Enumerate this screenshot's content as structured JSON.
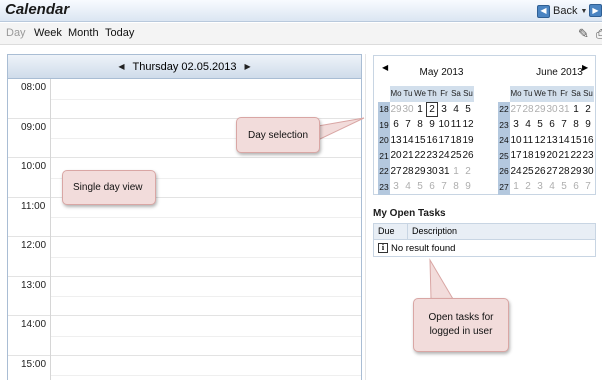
{
  "app": {
    "title": "Calendar"
  },
  "header": {
    "back_label": "Back",
    "back_icon": "back-arrow-icon",
    "exit_icon": "exit-icon"
  },
  "toolbar": {
    "views": [
      "Day",
      "Week",
      "Month",
      "Today"
    ],
    "active_view": "Day",
    "settings_icon": "settings-icon",
    "print_icon": "print-icon"
  },
  "day_view": {
    "date_label": "Thursday 02.05.2013",
    "hours": [
      "08:00",
      "09:00",
      "10:00",
      "11:00",
      "12:00",
      "13:00",
      "14:00",
      "15:00"
    ]
  },
  "navigator": {
    "weekday_headers": [
      "Mo",
      "Tu",
      "We",
      "Th",
      "Fr",
      "Sa",
      "Su"
    ],
    "selected_date": "02.05.2013",
    "months": [
      {
        "title": "May 2013",
        "weeks": [
          {
            "week": "18",
            "days": [
              [
                "29",
                "other"
              ],
              [
                "30",
                "other"
              ],
              [
                "1",
                ""
              ],
              [
                "2",
                "sel"
              ],
              [
                "3",
                ""
              ],
              [
                "4",
                ""
              ],
              [
                "5",
                ""
              ]
            ]
          },
          {
            "week": "19",
            "days": [
              [
                "6",
                ""
              ],
              [
                "7",
                ""
              ],
              [
                "8",
                ""
              ],
              [
                "9",
                ""
              ],
              [
                "10",
                ""
              ],
              [
                "11",
                ""
              ],
              [
                "12",
                ""
              ]
            ]
          },
          {
            "week": "20",
            "days": [
              [
                "13",
                ""
              ],
              [
                "14",
                ""
              ],
              [
                "15",
                ""
              ],
              [
                "16",
                ""
              ],
              [
                "17",
                ""
              ],
              [
                "18",
                ""
              ],
              [
                "19",
                ""
              ]
            ]
          },
          {
            "week": "21",
            "days": [
              [
                "20",
                ""
              ],
              [
                "21",
                ""
              ],
              [
                "22",
                ""
              ],
              [
                "23",
                ""
              ],
              [
                "24",
                ""
              ],
              [
                "25",
                ""
              ],
              [
                "26",
                ""
              ]
            ]
          },
          {
            "week": "22",
            "days": [
              [
                "27",
                ""
              ],
              [
                "28",
                ""
              ],
              [
                "29",
                ""
              ],
              [
                "30",
                ""
              ],
              [
                "31",
                ""
              ],
              [
                "1",
                "other"
              ],
              [
                "2",
                "other"
              ]
            ]
          },
          {
            "week": "23",
            "days": [
              [
                "3",
                "other"
              ],
              [
                "4",
                "other"
              ],
              [
                "5",
                "other"
              ],
              [
                "6",
                "other"
              ],
              [
                "7",
                "other"
              ],
              [
                "8",
                "other"
              ],
              [
                "9",
                "other"
              ]
            ]
          }
        ]
      },
      {
        "title": "June 2013",
        "weeks": [
          {
            "week": "22",
            "days": [
              [
                "27",
                "other"
              ],
              [
                "28",
                "other"
              ],
              [
                "29",
                "other"
              ],
              [
                "30",
                "other"
              ],
              [
                "31",
                "other"
              ],
              [
                "1",
                ""
              ],
              [
                "2",
                ""
              ]
            ]
          },
          {
            "week": "23",
            "days": [
              [
                "3",
                ""
              ],
              [
                "4",
                ""
              ],
              [
                "5",
                ""
              ],
              [
                "6",
                ""
              ],
              [
                "7",
                ""
              ],
              [
                "8",
                ""
              ],
              [
                "9",
                ""
              ]
            ]
          },
          {
            "week": "24",
            "days": [
              [
                "10",
                ""
              ],
              [
                "11",
                ""
              ],
              [
                "12",
                ""
              ],
              [
                "13",
                ""
              ],
              [
                "14",
                ""
              ],
              [
                "15",
                ""
              ],
              [
                "16",
                ""
              ]
            ]
          },
          {
            "week": "25",
            "days": [
              [
                "17",
                ""
              ],
              [
                "18",
                ""
              ],
              [
                "19",
                ""
              ],
              [
                "20",
                ""
              ],
              [
                "21",
                ""
              ],
              [
                "22",
                ""
              ],
              [
                "23",
                ""
              ]
            ]
          },
          {
            "week": "26",
            "days": [
              [
                "24",
                ""
              ],
              [
                "25",
                ""
              ],
              [
                "26",
                ""
              ],
              [
                "27",
                ""
              ],
              [
                "28",
                ""
              ],
              [
                "29",
                ""
              ],
              [
                "30",
                ""
              ]
            ]
          },
          {
            "week": "27",
            "days": [
              [
                "1",
                "other"
              ],
              [
                "2",
                "other"
              ],
              [
                "3",
                "other"
              ],
              [
                "4",
                "other"
              ],
              [
                "5",
                "other"
              ],
              [
                "6",
                "other"
              ],
              [
                "7",
                "other"
              ]
            ]
          }
        ]
      }
    ]
  },
  "tasks": {
    "title": "My Open Tasks",
    "columns": [
      "Due",
      "Description"
    ],
    "empty_text": "No result found"
  },
  "callouts": {
    "day_selection": "Day selection",
    "single_day_view": "Single day view",
    "open_tasks": "Open tasks for logged in user"
  },
  "colors": {
    "accent": "#4a84c2",
    "week_number_bg": "#b4c8de",
    "callout_bg": "#f2dcdb"
  }
}
